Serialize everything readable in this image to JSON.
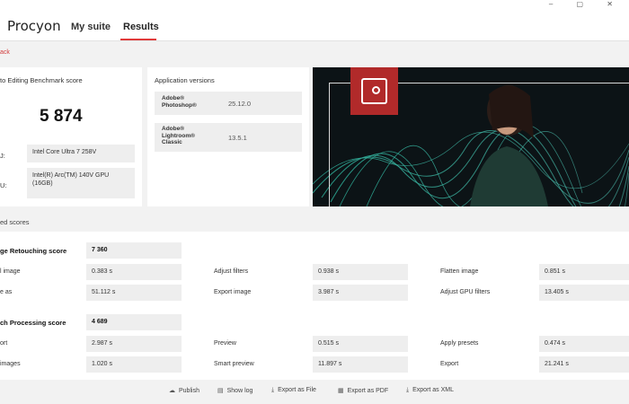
{
  "window": {
    "controls": "–  ▢  ✕"
  },
  "nav": {
    "logo": "Procyon",
    "tabs": [
      "My suite",
      "Results"
    ]
  },
  "back": {
    "label": "ack"
  },
  "benchmark": {
    "title": "to Editing Benchmark score",
    "score": "5 874",
    "cpu_label": "J:",
    "cpu_value": "Intel Core Ultra 7 258V",
    "gpu_label": "U:",
    "gpu_value": "Intel(R) Arc(TM) 140V GPU (16GB)"
  },
  "apps": {
    "title": "Application versions",
    "items": [
      {
        "name": "Adobe® Photoshop®",
        "version": "25.12.0"
      },
      {
        "name": "Adobe® Lightroom® Classic",
        "version": "13.5.1"
      }
    ]
  },
  "hero": {
    "badge_color": "#b12a2a"
  },
  "section": {
    "label": "ed scores"
  },
  "groups": [
    {
      "title": "ge Retouching score",
      "score": "7 360",
      "rows": [
        [
          {
            "label": "l image",
            "value": "0.383 s"
          },
          {
            "label": "Adjust filters",
            "value": "0.938 s"
          },
          {
            "label": "Flatten image",
            "value": "0.851 s"
          }
        ],
        [
          {
            "label": "e as",
            "value": "51.112 s"
          },
          {
            "label": "Export image",
            "value": "3.987 s"
          },
          {
            "label": "Adjust GPU filters",
            "value": "13.405 s"
          }
        ]
      ]
    },
    {
      "title": "ch Processing score",
      "score": "4 689",
      "rows": [
        [
          {
            "label": "ort",
            "value": "2.987 s"
          },
          {
            "label": "Preview",
            "value": "0.515 s"
          },
          {
            "label": "Apply presets",
            "value": "0.474 s"
          }
        ],
        [
          {
            "label": "images",
            "value": "1.020 s"
          },
          {
            "label": "Smart preview",
            "value": "11.897 s"
          },
          {
            "label": "Export",
            "value": "21.241 s"
          }
        ]
      ]
    }
  ],
  "footer": {
    "buttons": [
      {
        "label": "Publish",
        "icon": "cloud-upload-icon",
        "glyph": "☁"
      },
      {
        "label": "Show log",
        "icon": "document-icon",
        "glyph": "▤"
      },
      {
        "label": "Export as File",
        "icon": "download-icon",
        "glyph": "⤓"
      },
      {
        "label": "Export as PDF",
        "icon": "pdf-icon",
        "glyph": "▦"
      },
      {
        "label": "Export as XML",
        "icon": "download-icon",
        "glyph": "⤓"
      }
    ]
  },
  "colors": {
    "accent": "#e03a3a",
    "background": "#f2f2f2",
    "panel": "#ffffff",
    "value_box": "#eeeeee"
  }
}
